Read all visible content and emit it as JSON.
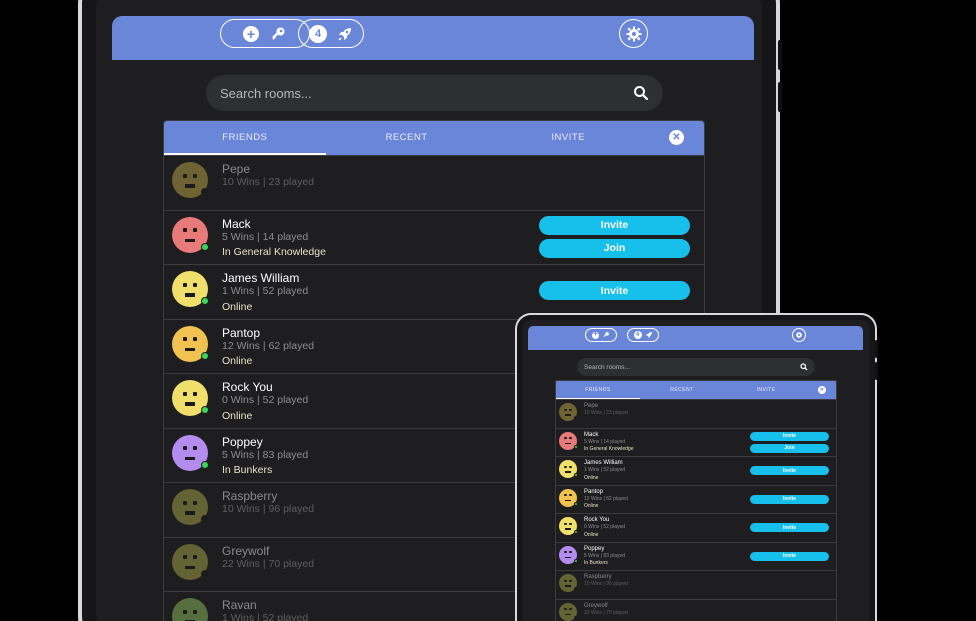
{
  "header": {
    "create_icon": "plus-circle-icon",
    "key_icon": "key-icon",
    "badge_count": "4",
    "rocket_icon": "rocket-icon",
    "settings_icon": "gear-icon"
  },
  "search": {
    "placeholder": "Search rooms...",
    "icon": "search-icon"
  },
  "tabs": [
    {
      "label": "FRIENDS",
      "active": true
    },
    {
      "label": "RECENT",
      "active": false
    },
    {
      "label": "INVITE",
      "active": false
    }
  ],
  "close_icon": "close-icon",
  "friends": [
    {
      "name": "Pepe",
      "stats": "10 Wins | 23 played",
      "status": "",
      "online": false,
      "color": "#8a7a3a",
      "buttons": []
    },
    {
      "name": "Mack",
      "stats": "5 Wins | 14 played",
      "status": "In General Knowledge",
      "online": true,
      "color": "#e87a7a",
      "buttons": [
        "Invite",
        "Join"
      ]
    },
    {
      "name": "James William",
      "stats": "1 Wins | 52 played",
      "status": "Online",
      "online": true,
      "color": "#f0df6a",
      "buttons": [
        "Invite"
      ]
    },
    {
      "name": "Pantop",
      "stats": "12 Wins | 62 played",
      "status": "Online",
      "online": true,
      "color": "#f2c250",
      "buttons": []
    },
    {
      "name": "Rock You",
      "stats": "0 Wins | 52 played",
      "status": "Online",
      "online": true,
      "color": "#f0df6a",
      "buttons": []
    },
    {
      "name": "Poppey",
      "stats": "5 Wins | 83 played",
      "status": "In Bunkers",
      "online": true,
      "color": "#b48cf0",
      "buttons": []
    },
    {
      "name": "Raspberry",
      "stats": "10 Wins | 96 played",
      "status": "",
      "online": false,
      "color": "#7a7a3a",
      "buttons": []
    },
    {
      "name": "Greywolf",
      "stats": "22 Wins | 70 played",
      "status": "",
      "online": false,
      "color": "#7a7a3a",
      "buttons": []
    },
    {
      "name": "Ravan",
      "stats": "1 Wins | 52 played",
      "status": "",
      "online": false,
      "color": "#6a8a4a",
      "buttons": []
    }
  ],
  "small_friends": [
    {
      "name": "Pepe",
      "stats": "10 Wins | 23 played",
      "status": "",
      "online": false,
      "color": "#8a7a3a",
      "buttons": []
    },
    {
      "name": "Mack",
      "stats": "5 Wins | 14 played",
      "status": "In General Knowledge",
      "online": true,
      "color": "#e87a7a",
      "buttons": [
        "Invite",
        "Join"
      ]
    },
    {
      "name": "James William",
      "stats": "1 Wins | 52 played",
      "status": "Online",
      "online": true,
      "color": "#f0df6a",
      "buttons": [
        "Invite"
      ]
    },
    {
      "name": "Pantop",
      "stats": "12 Wins | 62 played",
      "status": "Online",
      "online": true,
      "color": "#f2c250",
      "buttons": [
        "Invite"
      ]
    },
    {
      "name": "Rock You",
      "stats": "0 Wins | 52 played",
      "status": "Online",
      "online": true,
      "color": "#f0df6a",
      "buttons": [
        "Invite"
      ]
    },
    {
      "name": "Poppey",
      "stats": "5 Wins | 83 played",
      "status": "In Bunkers",
      "online": true,
      "color": "#b48cf0",
      "buttons": [
        "Invite"
      ]
    },
    {
      "name": "Raspberry",
      "stats": "10 Wins | 96 played",
      "status": "",
      "online": false,
      "color": "#7a7a3a",
      "buttons": []
    },
    {
      "name": "Greywolf",
      "stats": "22 Wins | 70 played",
      "status": "",
      "online": false,
      "color": "#7a7a3a",
      "buttons": []
    }
  ],
  "colors": {
    "accent": "#6a86d9",
    "button": "#17c0ea",
    "online": "#3ad65a",
    "offline": "#1a1a1a"
  }
}
